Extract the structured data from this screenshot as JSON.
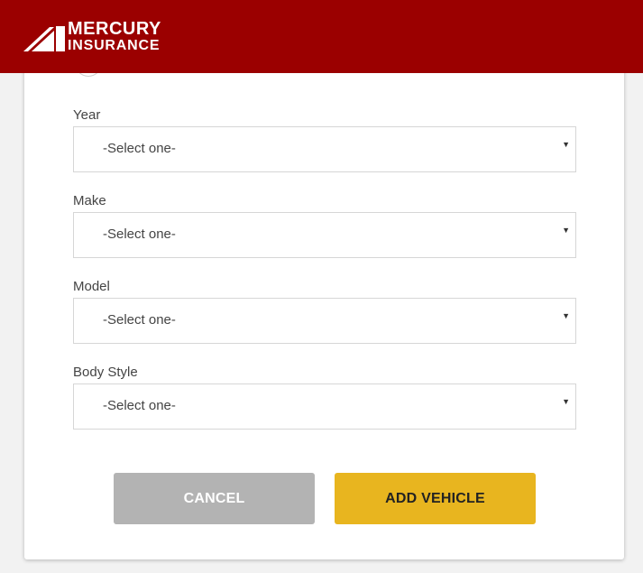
{
  "header": {
    "brand_line1": "MERCURY",
    "brand_line2": "INSURANCE",
    "color": "#9b0000"
  },
  "form": {
    "fields": [
      {
        "label": "Year",
        "value": "-Select one-"
      },
      {
        "label": "Make",
        "value": "-Select one-"
      },
      {
        "label": "Model",
        "value": "-Select one-"
      },
      {
        "label": "Body Style",
        "value": "-Select one-"
      }
    ]
  },
  "actions": {
    "cancel_label": "CANCEL",
    "add_label": "ADD VEHICLE",
    "cancel_color": "#b3b3b3",
    "add_color": "#e8b51f"
  },
  "icons": {
    "logo": "mercury-wing-logo",
    "dropdown": "triangle-down"
  }
}
